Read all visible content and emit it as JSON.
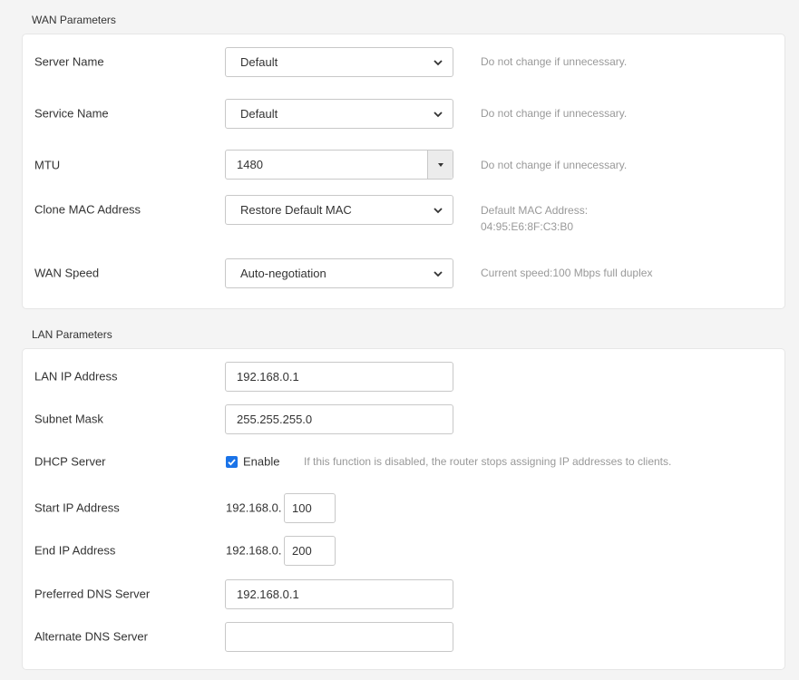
{
  "wan": {
    "title": "WAN Parameters",
    "server_name": {
      "label": "Server Name",
      "value": "Default",
      "hint": "Do not change if unnecessary."
    },
    "service_name": {
      "label": "Service Name",
      "value": "Default",
      "hint": "Do not change if unnecessary."
    },
    "mtu": {
      "label": "MTU",
      "value": "1480",
      "hint": "Do not change if unnecessary."
    },
    "clone_mac": {
      "label": "Clone MAC Address",
      "value": "Restore Default MAC",
      "hint_line1": "Default MAC Address:",
      "hint_line2": "04:95:E6:8F:C3:B0"
    },
    "wan_speed": {
      "label": "WAN Speed",
      "value": "Auto-negotiation",
      "hint": "Current speed:100 Mbps full duplex"
    }
  },
  "lan": {
    "title": "LAN Parameters",
    "lan_ip": {
      "label": "LAN IP Address",
      "value": "192.168.0.1"
    },
    "subnet_mask": {
      "label": "Subnet Mask",
      "value": "255.255.255.0"
    },
    "dhcp": {
      "label": "DHCP Server",
      "checked": true,
      "checkbox_label": "Enable",
      "hint": "If this function is disabled, the router stops assigning IP addresses to clients."
    },
    "start_ip": {
      "label": "Start IP Address",
      "prefix": "192.168.0.",
      "value": "100"
    },
    "end_ip": {
      "label": "End IP Address",
      "prefix": "192.168.0.",
      "value": "200"
    },
    "preferred_dns": {
      "label": "Preferred DNS Server",
      "value": "192.168.0.1"
    },
    "alternate_dns": {
      "label": "Alternate DNS Server",
      "value": ""
    }
  },
  "colors": {
    "accent": "#1a73e8",
    "hint": "#999999",
    "card_bg": "#ffffff",
    "page_bg": "#f4f4f4"
  }
}
